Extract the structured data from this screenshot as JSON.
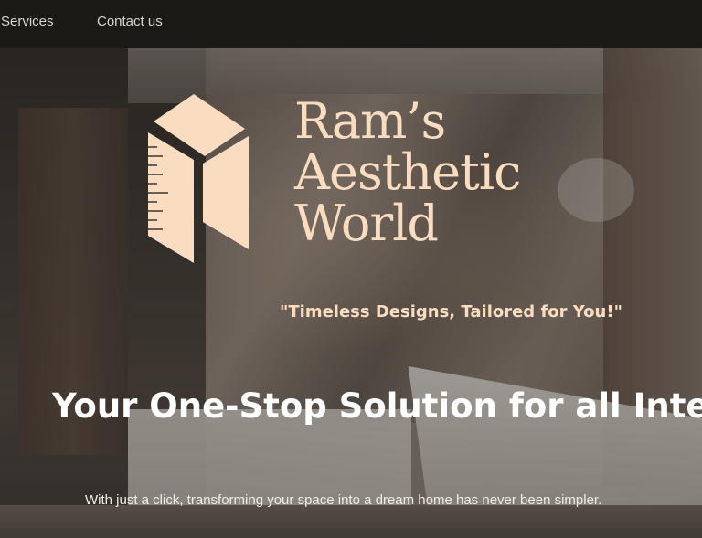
{
  "nav": {
    "items": [
      {
        "label": "Services"
      },
      {
        "label": "Contact us"
      }
    ]
  },
  "hero": {
    "brand": {
      "line1": "Ram’s",
      "line2": "Aesthetic",
      "line3": "World"
    },
    "tagline": "\"Timeless Designs, Tailored for You!\"",
    "headline": "Your One-Stop Solution for all Interior",
    "subtext": "With just a click, transforming your space into a dream home has never been simpler."
  },
  "colors": {
    "nav_background": "#1b1a17",
    "brand_accent": "#fadcc0",
    "headline": "#ffffff"
  },
  "icons": {
    "logo": "ruler-cube-logo-icon"
  }
}
